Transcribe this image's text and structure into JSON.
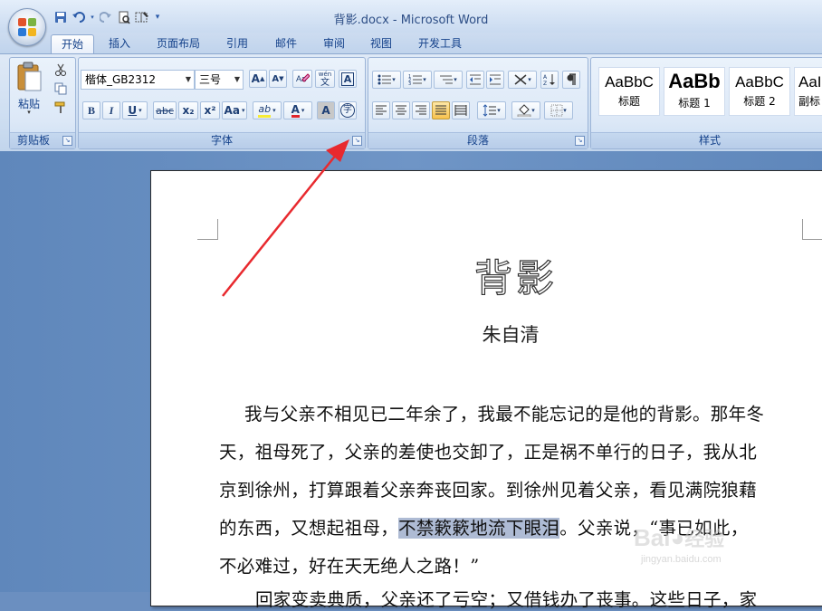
{
  "window": {
    "title": "背影.docx - Microsoft Word"
  },
  "quick_access": {
    "icons": [
      "save-icon",
      "undo-icon",
      "redo-icon",
      "print-preview-icon",
      "draw-table-icon",
      "customize-qat-icon"
    ]
  },
  "tabs": [
    {
      "label": "开始",
      "active": true
    },
    {
      "label": "插入"
    },
    {
      "label": "页面布局"
    },
    {
      "label": "引用"
    },
    {
      "label": "邮件"
    },
    {
      "label": "审阅"
    },
    {
      "label": "视图"
    },
    {
      "label": "开发工具"
    }
  ],
  "clipboard": {
    "label": "剪贴板",
    "paste_label": "粘贴"
  },
  "font": {
    "label": "字体",
    "font_name": "楷体_GB2312",
    "font_size": "三号",
    "grow": "A",
    "shrink": "A",
    "bold": "B",
    "italic": "I",
    "underline": "U",
    "strike": "abc",
    "subscript": "x₂",
    "superscript": "x²",
    "change_case": "Aa",
    "highlight": "ab",
    "font_color": "A",
    "char_shading": "A",
    "enclose_char": "字",
    "phonetic": "wén",
    "phonetic_char": "文",
    "char_border": "A"
  },
  "paragraph": {
    "label": "段落"
  },
  "styles": {
    "label": "样式",
    "cards": [
      {
        "sample": "AaBbC",
        "name": "标题"
      },
      {
        "sample": "AaBb",
        "name": "标题 1"
      },
      {
        "sample": "AaBbC",
        "name": "标题 2"
      },
      {
        "sample": "AaI",
        "name": "副标"
      }
    ]
  },
  "document": {
    "title": "背影",
    "author": "朱自清",
    "paragraph_lines": [
      "我与父亲不相见已二年余了，我最不能忘记的是他的背影。那年冬",
      "天，祖母死了，父亲的差使也交卸了，正是祸不单行的日子，我从北",
      "京到徐州，打算跟着父亲奔丧回家。到徐州见着父亲，看见满院狼藉"
    ],
    "line4_before": "的东西，又想起祖母，",
    "line4_selected": "不禁簌簌地流下眼泪",
    "line4_after": "。父亲说，“事已如此，",
    "line5": "不必难过，好在天无绝人之路！”",
    "line6_partial": "回家变卖典质，父亲还了亏空；又借钱办了丧事。这些日子，家"
  },
  "watermark": {
    "brand": "Bai",
    "brand_suffix": "经验",
    "url": "jingyan.baidu.com"
  },
  "colors": {
    "accent": "#15428b",
    "selection": "#aebbd4",
    "arrow": "#e8292e"
  }
}
